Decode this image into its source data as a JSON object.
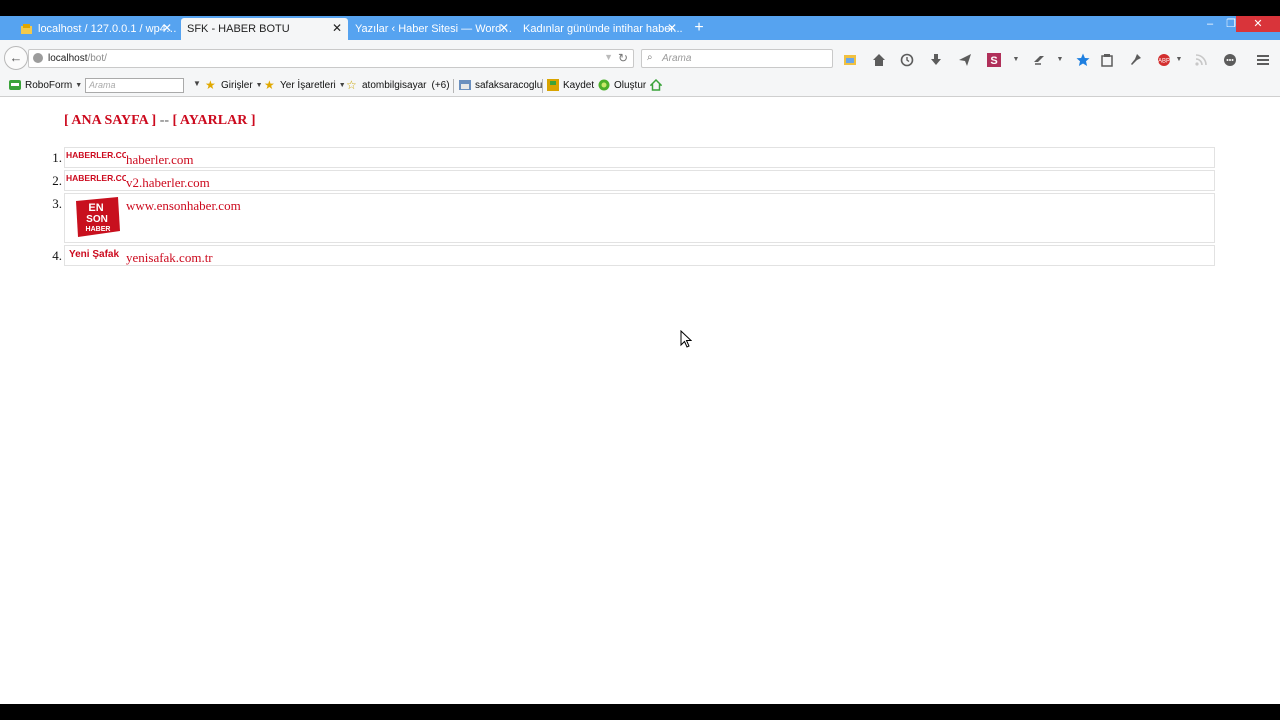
{
  "window": {
    "minimize": "–",
    "maximize": "❐",
    "close": "✕"
  },
  "tabs": [
    {
      "title": "localhost / 127.0.0.1 / wp4 ...",
      "active": false
    },
    {
      "title": "SFK - HABER BOTU",
      "active": true
    },
    {
      "title": "Yazılar ‹ Haber Sitesi — WordPr...",
      "active": false
    },
    {
      "title": "Kadınlar gününde intihar haber...",
      "active": false
    }
  ],
  "tab_close": "✕",
  "new_tab": "+",
  "nav": {
    "back": "←",
    "url_host": "localhost",
    "url_path": "/bot/",
    "reload": "↻",
    "search_placeholder": "Arama"
  },
  "toolbar_icons": [
    "reader-icon",
    "home-icon",
    "history-icon",
    "download-icon",
    "send-icon",
    "s-extension-icon",
    "sync-icon",
    "bookmark-star-icon",
    "clipboard-icon",
    "pin-icon",
    "addon-icon",
    "rss-icon",
    "chat-icon",
    "menu-icon"
  ],
  "bookmarks": {
    "roboform": "RoboForm",
    "search_placeholder": "Arama",
    "girisler": "Girişler",
    "yer_isaretleri": "Yer İşaretleri",
    "atombilgisayar": "atombilgisayar",
    "more": "(+6)",
    "safaksaracoglu": "safaksaracoglu",
    "kaydet": "Kaydet",
    "olustur": "Oluştur"
  },
  "page": {
    "menu_home": "[ ANA SAYFA ]",
    "menu_sep": "--",
    "menu_settings": "[ AYARLAR ]",
    "sites": [
      {
        "num": "1.",
        "logo": "HABERLER.COM",
        "link": "haberler.com"
      },
      {
        "num": "2.",
        "logo": "HABERLER.COM",
        "link": "v2.haberler.com"
      },
      {
        "num": "3.",
        "logo": "EN SON HABER",
        "link": "www.ensonhaber.com"
      },
      {
        "num": "4.",
        "logo": "Yeni Şafak",
        "link": "yenisafak.com.tr"
      }
    ]
  },
  "colors": {
    "tabstrip": "#56a3f0",
    "link": "#cc0a1e",
    "close": "#d9343a"
  }
}
